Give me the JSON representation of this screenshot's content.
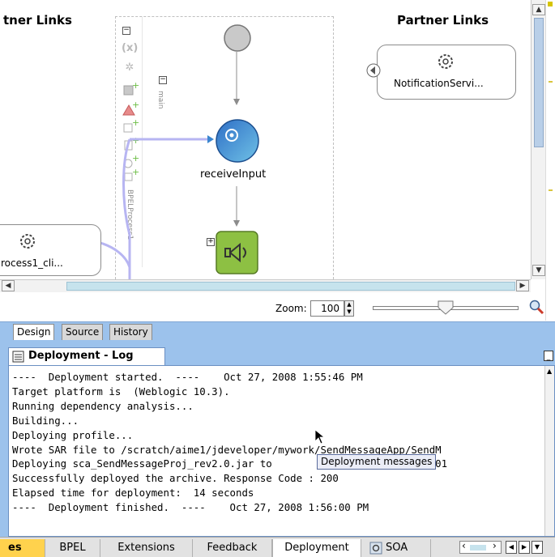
{
  "canvas": {
    "left_partner_title": "tner Links",
    "right_partner_title": "Partner Links",
    "palette_icons": [
      "collapse-icon",
      "variable-icon",
      "gear-icon",
      "add-partner-icon",
      "remove-partner-icon",
      "add-correlation-icon",
      "edit-icon",
      "add-message-icon",
      "add-variable-icon"
    ],
    "scope_label": "main",
    "process_label": "BPELProcess1",
    "activities": {
      "receive_label": "receiveInput"
    },
    "left_partner_label": "rocess1_cli...",
    "right_partner_label": "NotificationServi..."
  },
  "zoom": {
    "label": "Zoom:",
    "value": "100"
  },
  "design_tabs": [
    "Design",
    "Source",
    "History"
  ],
  "log": {
    "tab_title": "Deployment - Log",
    "lines": [
      "----  Deployment started.  ----    Oct 27, 2008 1:55:46 PM",
      "Target platform is  (Weblogic 10.3).",
      "Running dependency analysis...",
      "Building...",
      "Deploying profile...",
      "Wrote SAR file to /scratch/aime1/jdeveloper/mywork/SendMessageApp/SendM",
      "Deploying sca_SendMessageProj_rev2.0.jar to                 cle.com:8001",
      "Successfully deployed the archive. Response Code : 200",
      "Elapsed time for deployment:  14 seconds",
      "----  Deployment finished.  ----    Oct 27, 2008 1:56:00 PM"
    ],
    "tooltip": "Deployment messages"
  },
  "bottom_tabs": {
    "partial_label": "es",
    "tabs": [
      "BPEL",
      "Extensions",
      "Feedback",
      "Deployment",
      "SOA"
    ],
    "active": "Deployment"
  },
  "colors": {
    "panel_blue": "#9cc2ec",
    "tab_border": "#6b8fc2",
    "receive_blue": "#3b86cf",
    "invoke_green": "#8dc043",
    "connector_purple": "#b7b5f2"
  }
}
